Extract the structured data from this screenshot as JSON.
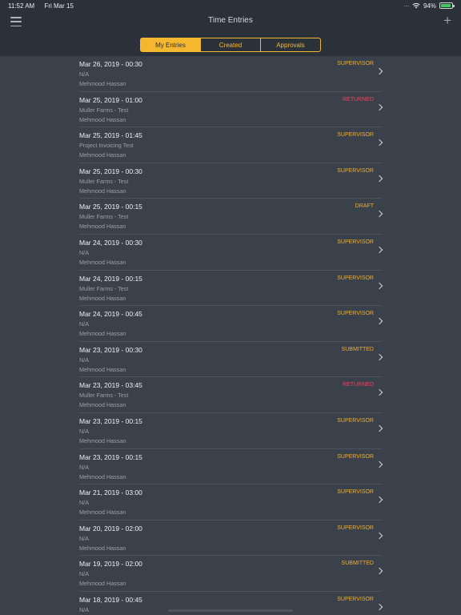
{
  "status_bar": {
    "time": "11:52 AM",
    "date": "Fri Mar 15",
    "battery": "94%",
    "battery_level": 0.94
  },
  "nav": {
    "title": "Time Entries"
  },
  "segments": [
    {
      "label": "My Entries",
      "active": true
    },
    {
      "label": "Created",
      "active": false
    },
    {
      "label": "Approvals",
      "active": false
    }
  ],
  "entries": [
    {
      "date": "Mar 26, 2019 - 00:30",
      "project": "N/A",
      "person": "Mehmood Hassan",
      "status": "SUPERVISOR"
    },
    {
      "date": "Mar 25, 2019 - 01:00",
      "project": "Muller Farms - Test",
      "person": "Mehmood Hassan",
      "status": "RETURNED"
    },
    {
      "date": "Mar 25, 2019 - 01:45",
      "project": "Project Invoicing Test",
      "person": "Mehmood Hassan",
      "status": "SUPERVISOR"
    },
    {
      "date": "Mar 25, 2019 - 00:30",
      "project": "Muller Farms - Test",
      "person": "Mehmood Hassan",
      "status": "SUPERVISOR"
    },
    {
      "date": "Mar 25, 2019 - 00:15",
      "project": "Muller Farms - Test",
      "person": "Mehmood Hassan",
      "status": "DRAFT"
    },
    {
      "date": "Mar 24, 2019 - 00:30",
      "project": "N/A",
      "person": "Mehmood Hassan",
      "status": "SUPERVISOR"
    },
    {
      "date": "Mar 24, 2019 - 00:15",
      "project": "Muller Farms - Test",
      "person": "Mehmood Hassan",
      "status": "SUPERVISOR"
    },
    {
      "date": "Mar 24, 2019 - 00:45",
      "project": "N/A",
      "person": "Mehmood Hassan",
      "status": "SUPERVISOR"
    },
    {
      "date": "Mar 23, 2019 - 00:30",
      "project": "N/A",
      "person": "Mehmood Hassan",
      "status": "SUBMITTED"
    },
    {
      "date": "Mar 23, 2019 - 03:45",
      "project": "Muller Farms - Test",
      "person": "Mehmood Hassan",
      "status": "RETURNED"
    },
    {
      "date": "Mar 23, 2019 - 00:15",
      "project": "N/A",
      "person": "Mehmood Hassan",
      "status": "SUPERVISOR"
    },
    {
      "date": "Mar 23, 2019 - 00:15",
      "project": "N/A",
      "person": "Mehmood Hassan",
      "status": "SUPERVISOR"
    },
    {
      "date": "Mar 21, 2019 - 03:00",
      "project": "N/A",
      "person": "Mehmood Hassan",
      "status": "SUPERVISOR"
    },
    {
      "date": "Mar 20, 2019 - 02:00",
      "project": "N/A",
      "person": "Mehmood Hassan",
      "status": "SUPERVISOR"
    },
    {
      "date": "Mar 19, 2019 - 02:00",
      "project": "N/A",
      "person": "Mehmood Hassan",
      "status": "SUBMITTED"
    },
    {
      "date": "Mar 18, 2019 - 00:45",
      "project": "N/A",
      "person": "",
      "status": "SUPERVISOR"
    }
  ]
}
